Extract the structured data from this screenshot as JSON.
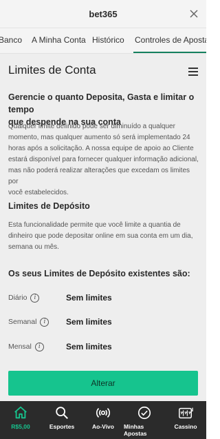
{
  "header": {
    "title": "bet365",
    "close_icon": "close-icon"
  },
  "tabs": [
    {
      "label": "Banco"
    },
    {
      "label": "A Minha Conta"
    },
    {
      "label": "Histórico"
    },
    {
      "label": "Controles de Aposta",
      "active": true
    }
  ],
  "page": {
    "title": "Limites de Conta",
    "intro_heading_line1": "Gerencie o quanto Deposita, Gasta e limitar o tempo",
    "intro_heading_line2": "que despende na sua conta",
    "intro_text": [
      "Qualquer limite definido pode ser diminuído a qualquer",
      "momento, mas qualquer aumento só será implementado 24",
      "horas após a solicitação. A nossa equipe de apoio ao Cliente",
      "estará disponível para fornecer qualquer informação adicional,",
      "mas não poderá realizar alterações que excedam os limites por",
      "você estabelecidos."
    ],
    "deposit_heading": "Limites de Depósito",
    "deposit_text": [
      "Esta funcionalidade permite que você limite a quantia de",
      "dinheiro que pode depositar online em sua conta em um dia,",
      "semana ou mês."
    ],
    "existing_heading": "Os seus Limites de Depósito existentes são:",
    "limits": [
      {
        "label": "Diário",
        "value": "Sem limites"
      },
      {
        "label": "Semanal",
        "value": "Sem limites"
      },
      {
        "label": "Mensal",
        "value": "Sem limites"
      }
    ],
    "info_glyph": "i",
    "button_label": "Alterar"
  },
  "bottom_nav": [
    {
      "label": "R$5,00",
      "icon": "home-icon",
      "active": true
    },
    {
      "label": "Esportes",
      "icon": "search-icon"
    },
    {
      "label": "Ao-Vivo",
      "icon": "live-broadcast-icon"
    },
    {
      "label": "Minhas Apostas",
      "icon": "check-circle-icon"
    },
    {
      "label": "Cassino",
      "icon": "slot-machine-icon"
    }
  ],
  "colors": {
    "accent": "#16c48e",
    "tab_underline": "#14805e",
    "nav_bg": "#2b2b2b",
    "content_bg": "#eeeeee"
  }
}
